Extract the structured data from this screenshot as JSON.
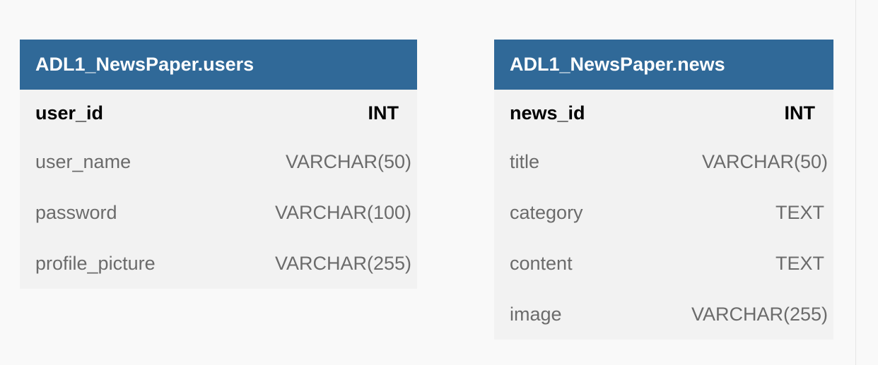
{
  "tables": [
    {
      "name": "ADL1_NewsPaper.users",
      "columns": [
        {
          "name": "user_id",
          "type": "INT",
          "primary_key": true
        },
        {
          "name": "user_name",
          "type": "VARCHAR(50)",
          "primary_key": false
        },
        {
          "name": "password",
          "type": "VARCHAR(100)",
          "primary_key": false
        },
        {
          "name": "profile_picture",
          "type": "VARCHAR(255)",
          "primary_key": false
        }
      ]
    },
    {
      "name": "ADL1_NewsPaper.news",
      "columns": [
        {
          "name": "news_id",
          "type": "INT",
          "primary_key": true
        },
        {
          "name": "title",
          "type": "VARCHAR(50)",
          "primary_key": false
        },
        {
          "name": "category",
          "type": "TEXT",
          "primary_key": false
        },
        {
          "name": "content",
          "type": "TEXT",
          "primary_key": false
        },
        {
          "name": "image",
          "type": "VARCHAR(255)",
          "primary_key": false
        }
      ]
    }
  ],
  "colors": {
    "header_bg": "#306998",
    "header_text": "#ffffff",
    "body_bg": "#f2f2f2",
    "page_bg": "#f9f9f9",
    "pk_text": "#000000",
    "column_text": "#6b6b6b"
  }
}
